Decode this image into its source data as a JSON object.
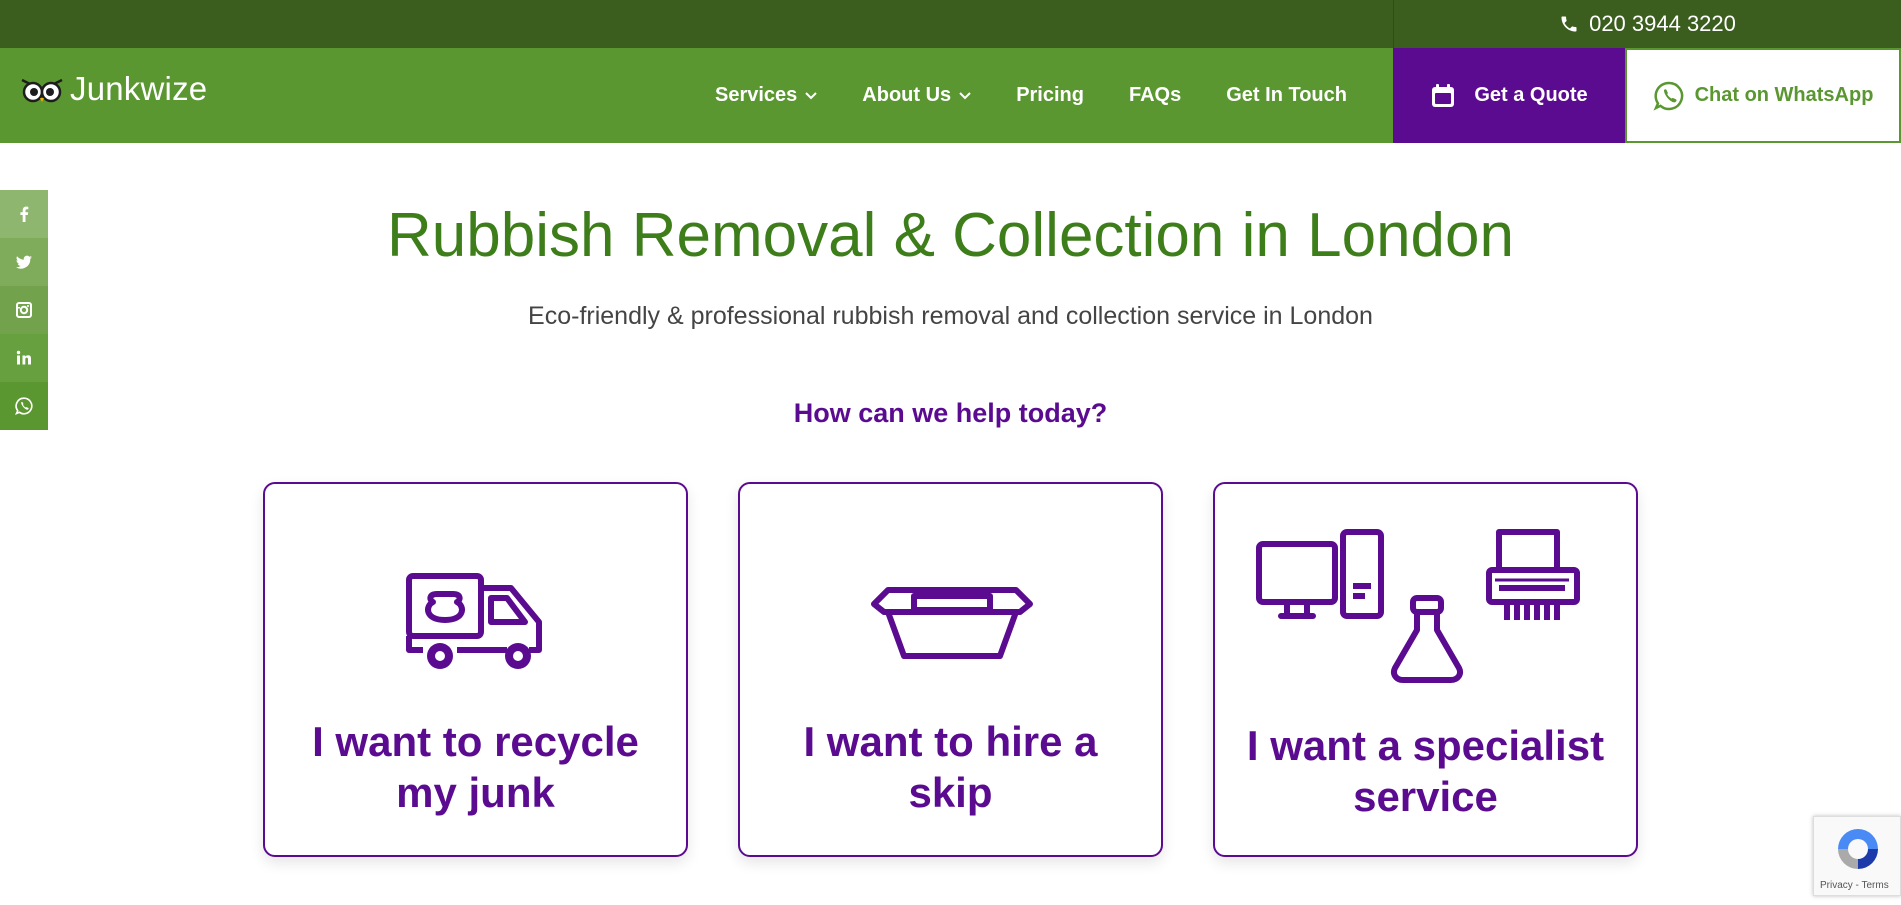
{
  "topbar": {
    "phone": "020 3944 3220",
    "icon": "phone-icon"
  },
  "brand": {
    "name": "Junkwize",
    "icon": "owl-logo-icon"
  },
  "nav": {
    "items": [
      {
        "label": "Services",
        "has_dropdown": true
      },
      {
        "label": "About Us",
        "has_dropdown": true
      },
      {
        "label": "Pricing",
        "has_dropdown": false
      },
      {
        "label": "FAQs",
        "has_dropdown": false
      },
      {
        "label": "Get In Touch",
        "has_dropdown": false
      }
    ],
    "quote_label": "Get a Quote",
    "whatsapp_label": "Chat on WhatsApp"
  },
  "social": [
    "facebook-icon",
    "twitter-icon",
    "instagram-icon",
    "linkedin-icon",
    "whatsapp-icon"
  ],
  "hero": {
    "title": "Rubbish Removal & Collection in London",
    "subtitle": "Eco-friendly & professional rubbish removal and collection service in London",
    "help_title": "How can we help today?"
  },
  "cards": [
    {
      "line1": "I want to recycle",
      "line2": "my junk",
      "icon": "junk-truck-icon"
    },
    {
      "line1": "I want to hire a",
      "line2": "skip",
      "icon": "skip-icon"
    },
    {
      "line1": "I want a specialist",
      "line2": "service",
      "icon": "specialist-services-icon"
    }
  ],
  "recaptcha": {
    "text": "Privacy - Terms"
  },
  "colors": {
    "brand_green": "#5b9731",
    "dark_green": "#3b5e1f",
    "heading_green": "#3d7d1a",
    "purple": "#5a0b8f"
  }
}
